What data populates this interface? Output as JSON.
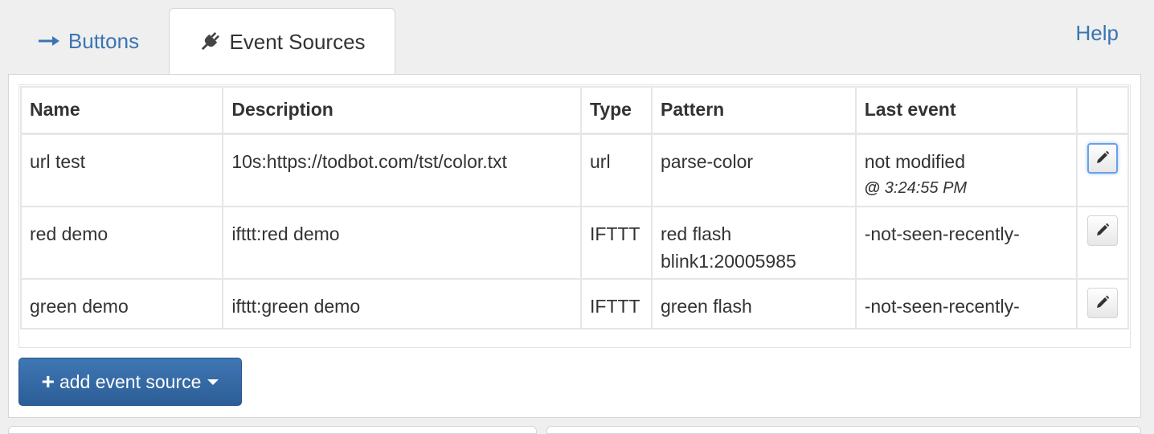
{
  "tabs": [
    {
      "label": "Buttons",
      "icon": "arrow-right-icon"
    },
    {
      "label": "Event Sources",
      "icon": "plug-icon",
      "active": true
    }
  ],
  "help_link": "Help",
  "table": {
    "columns": [
      "Name",
      "Description",
      "Type",
      "Pattern",
      "Last event",
      ""
    ],
    "rows": [
      {
        "name": "url test",
        "description": "10s:https://todbot.com/tst/color.txt",
        "type": "url",
        "pattern": "parse-color",
        "pattern2": "",
        "last_event": "not modified",
        "last_event_time_prefix": "@",
        "last_event_time": "3:24:55 PM"
      },
      {
        "name": "red demo",
        "description": "ifttt:red demo",
        "type": "IFTTT",
        "pattern": "red flash",
        "pattern2": "blink1:20005985",
        "last_event": "-not-seen-recently-"
      },
      {
        "name": "green demo",
        "description": "ifttt:green demo",
        "type": "IFTTT",
        "pattern": "green flash",
        "pattern2": "",
        "last_event": "-not-seen-recently-"
      }
    ]
  },
  "add_button": {
    "label": "add event source",
    "icon": "plus-icon"
  },
  "colors": {
    "link": "#3a74b4",
    "primary_button": "#2c5e96",
    "focus_ring": "#6aa0e8"
  }
}
